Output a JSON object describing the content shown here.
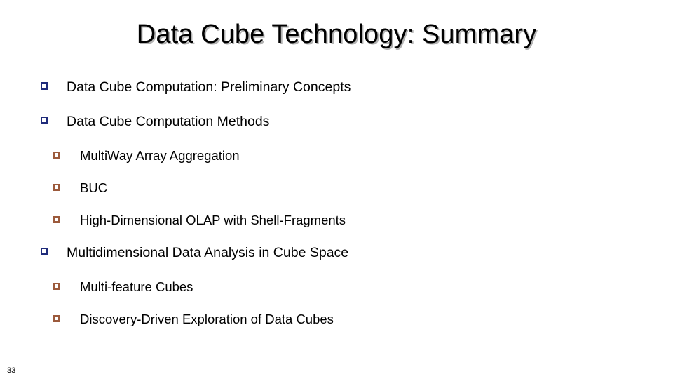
{
  "slide": {
    "title": "Data Cube Technology: Summary",
    "page_number": "33",
    "colors": {
      "title_text": "#000000",
      "title_shadow": "#B3B3B3",
      "rule": "#7F7F7F",
      "level1_bullet": "#1F2B7B",
      "level2_bullet": "#9C5A3C",
      "body_text": "#000000",
      "background": "#FFFFFF"
    }
  },
  "bullets": [
    {
      "level": 1,
      "marker": "hollow-square-icon",
      "text": "Data Cube Computation: Preliminary Concepts"
    },
    {
      "level": 1,
      "marker": "hollow-square-icon",
      "text": "Data Cube Computation Methods"
    },
    {
      "level": 2,
      "marker": "hollow-square-icon",
      "text": "MultiWay Array Aggregation"
    },
    {
      "level": 2,
      "marker": "hollow-square-icon",
      "text": "BUC"
    },
    {
      "level": 2,
      "marker": "hollow-square-icon",
      "text": "High-Dimensional OLAP with Shell-Fragments"
    },
    {
      "level": 1,
      "marker": "hollow-square-icon",
      "text": "Multidimensional Data Analysis in Cube Space"
    },
    {
      "level": 2,
      "marker": "hollow-square-icon",
      "text": "Multi-feature Cubes"
    },
    {
      "level": 2,
      "marker": "hollow-square-icon",
      "text": "Discovery-Driven Exploration of Data Cubes"
    }
  ]
}
